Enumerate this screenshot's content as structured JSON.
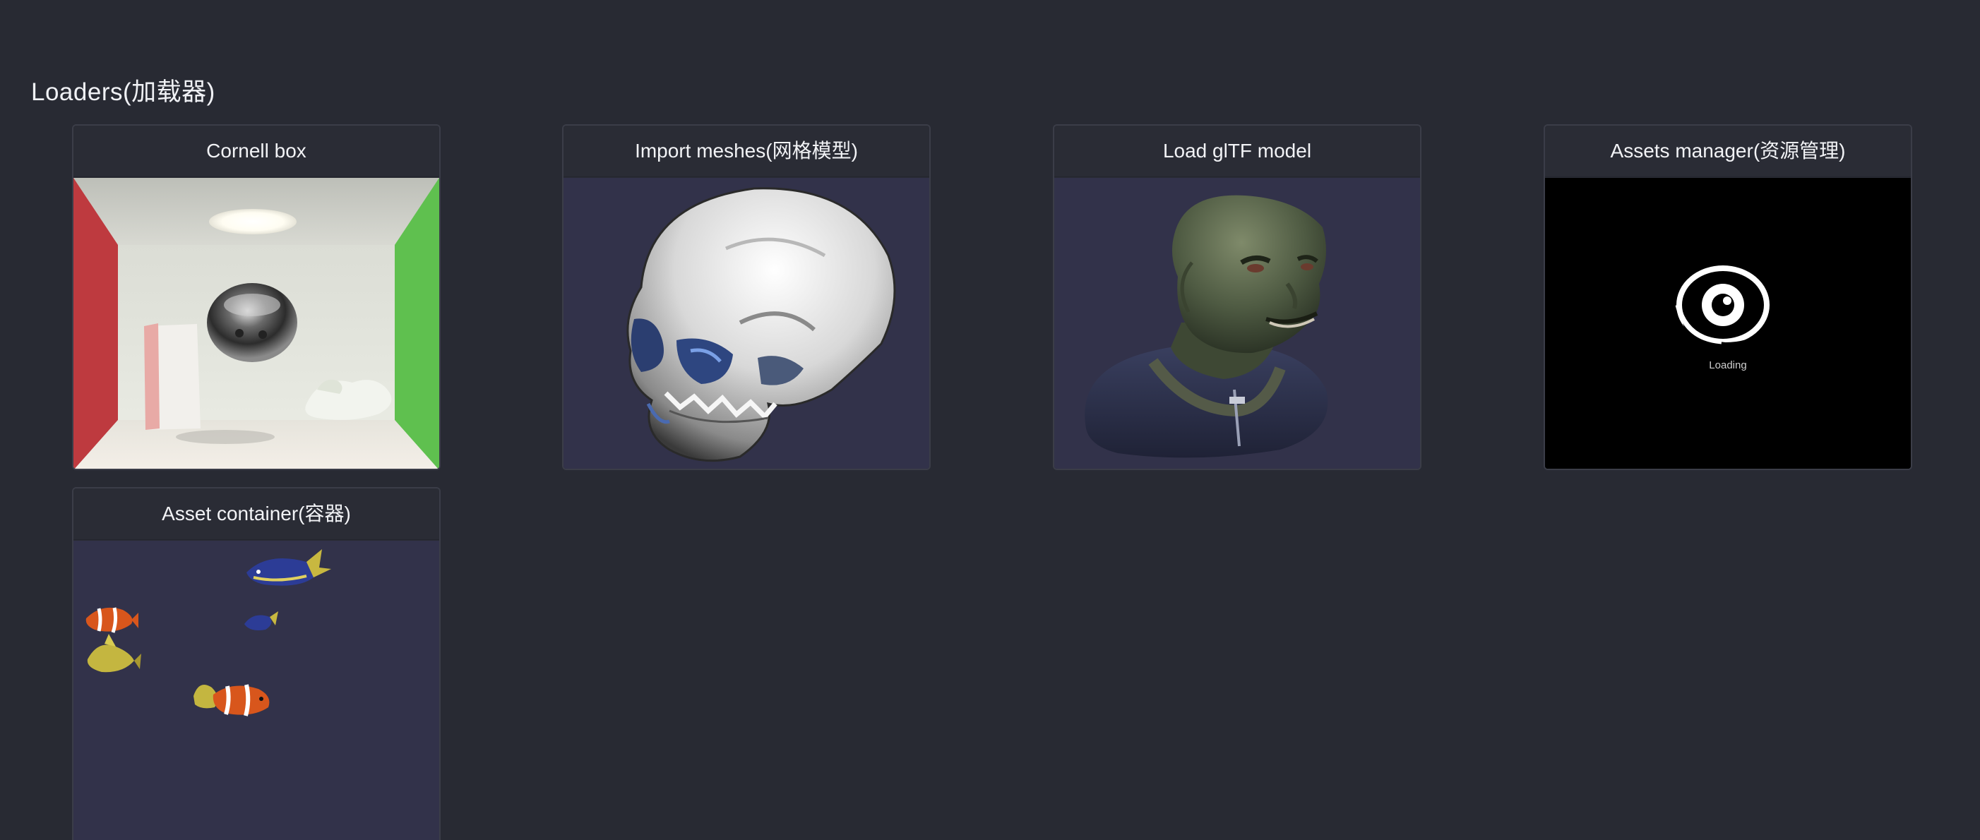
{
  "section": {
    "title": "Loaders(加载器)"
  },
  "cards": [
    {
      "title": "Cornell box",
      "thumbnail": "cornell-box-render"
    },
    {
      "title": "Import meshes(网格模型)",
      "thumbnail": "skull-mesh-render"
    },
    {
      "title": "Load glTF model",
      "thumbnail": "alien-bust-render"
    },
    {
      "title": "Assets manager(资源管理)",
      "thumbnail": "loading-screen",
      "loading_text": "Loading"
    },
    {
      "title": "Asset container(容器)",
      "thumbnail": "fish-scene-render"
    }
  ],
  "colors": {
    "background": "#282a33",
    "card_header": "#2a2c35",
    "card_border": "#3b3d48",
    "scene_background": "#32324a"
  }
}
